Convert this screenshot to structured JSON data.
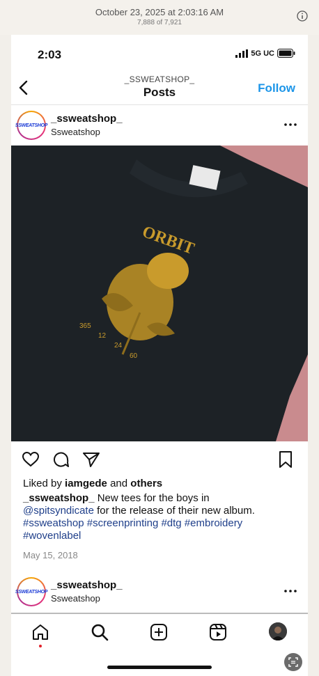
{
  "viewer": {
    "date": "October 23, 2025 at 2:03:16 AM",
    "count": "7,888 of 7,921",
    "info_icon": "info-icon"
  },
  "status": {
    "time": "2:03",
    "network": "5G UC"
  },
  "header": {
    "username": "_SSWEATSHOP_",
    "title": "Posts",
    "follow_label": "Follow"
  },
  "post": {
    "avatar_text": "SSWEATSHOP",
    "username": "_ssweatshop_",
    "display_name": "Ssweatshop",
    "image_text": {
      "brand": "ORBIT",
      "nums": [
        "365",
        "12",
        "24",
        "60"
      ]
    },
    "liked_prefix": "Liked by ",
    "liked_user": "iamgede",
    "liked_and": " and ",
    "liked_others": "others",
    "caption_user": "_ssweatshop_",
    "caption_text": " New tees for the boys in",
    "mention": "@spitsyndicate",
    "caption_text2": " for the release of their new album.",
    "hashtags_line1": "#ssweatshop #screenprinting #dtg #embroidery",
    "hashtags_line2": "#wovenlabel",
    "date": "May 15, 2018"
  },
  "next_post": {
    "avatar_text": "SSWEATSHOP",
    "username": "_ssweatshop_",
    "display_name": "Ssweatshop"
  },
  "nav": [
    "home-icon",
    "search-icon",
    "add-icon",
    "reels-icon",
    "profile-avatar"
  ]
}
